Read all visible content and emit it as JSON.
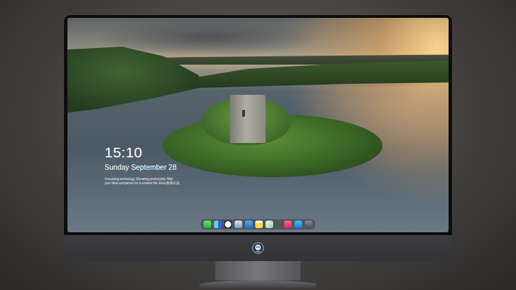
{
  "lock_screen": {
    "time": "15:10",
    "date": "Sunday September 28",
    "tagline": "Innovating technology, Elevating productivity. Mac, your ideal companion for a smarter life. Ezos鼎鼎出品"
  }
}
